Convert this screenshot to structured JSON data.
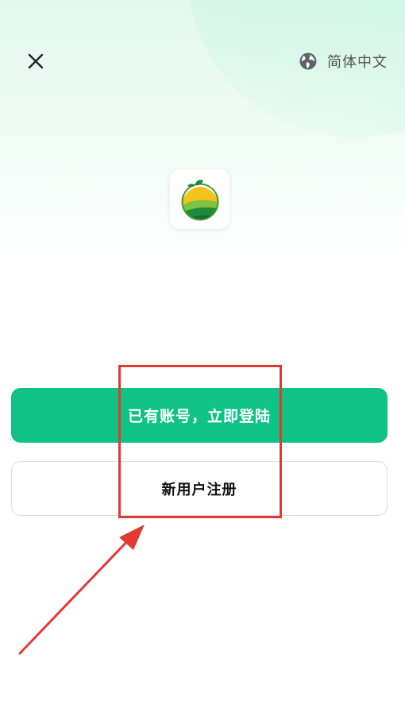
{
  "header": {
    "close_icon": "close-icon",
    "language": {
      "icon": "globe-icon",
      "label": "简体中文"
    }
  },
  "logo": {
    "icon": "orange-farm-logo-icon",
    "colors": {
      "leaf": "#1a8a3f",
      "sun": "#f3c21b",
      "field_light": "#7fc242",
      "field_dark": "#1f8a3a"
    }
  },
  "actions": {
    "login_label": "已有账号，立即登陆",
    "register_label": "新用户注册"
  },
  "colors": {
    "primary": "#0fc285",
    "annotation": "#e03a33"
  }
}
